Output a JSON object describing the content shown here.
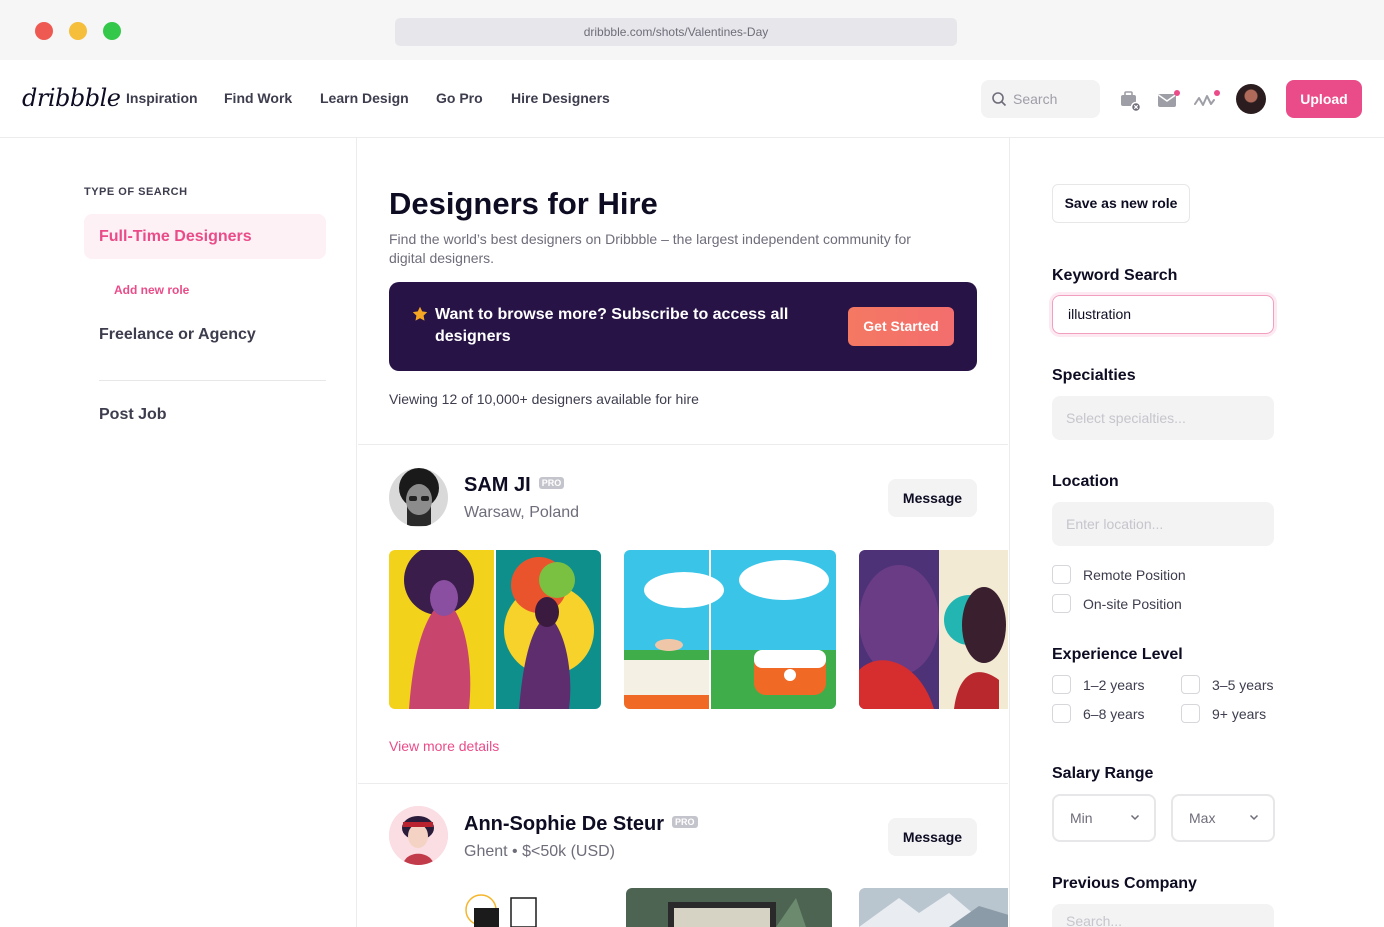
{
  "browser": {
    "url": "dribbble.com/shots/Valentines-Day"
  },
  "nav": {
    "logo": "dribbble",
    "links": [
      "Inspiration",
      "Find Work",
      "Learn Design",
      "Go Pro",
      "Hire Designers"
    ],
    "search_placeholder": "Search",
    "upload_label": "Upload"
  },
  "left": {
    "section_label": "TYPE OF SEARCH",
    "active_item": "Full-Time Designers",
    "add_role": "Add new role",
    "items": [
      "Freelance or Agency",
      "Post Job"
    ]
  },
  "main": {
    "title": "Designers for Hire",
    "subtitle": "Find the world’s best designers on Dribbble – the largest independent community for digital designers.",
    "promo_text": "Want to browse more? Subscribe to access all designers",
    "promo_button": "Get Started",
    "viewing": "Viewing 12 of 10,000+ designers available for hire",
    "designers": [
      {
        "name": "SAM JI",
        "badge": "PRO",
        "location": "Warsaw, Poland",
        "message": "Message",
        "view_more": "View more details"
      },
      {
        "name": "Ann-Sophie De Steur",
        "badge": "PRO",
        "location": "Ghent  •  $<50k (USD)",
        "message": "Message"
      }
    ]
  },
  "right": {
    "save_role": "Save as new role",
    "keyword_label": "Keyword Search",
    "keyword_value": "illustration",
    "specialties_label": "Specialties",
    "specialties_placeholder": "Select specialties...",
    "location_label": "Location",
    "location_placeholder": "Enter location...",
    "remote": "Remote Position",
    "onsite": "On-site Position",
    "experience_label": "Experience Level",
    "exp": [
      "1–2 years",
      "3–5 years",
      "6–8 years",
      "9+ years"
    ],
    "salary_label": "Salary Range",
    "salary_min": "Min",
    "salary_max": "Max",
    "company_label": "Previous Company",
    "company_placeholder": "Search..."
  },
  "colors": {
    "brand_pink": "#ea4c89",
    "promo_bg": "#281347",
    "promo_btn": "#f47862"
  }
}
